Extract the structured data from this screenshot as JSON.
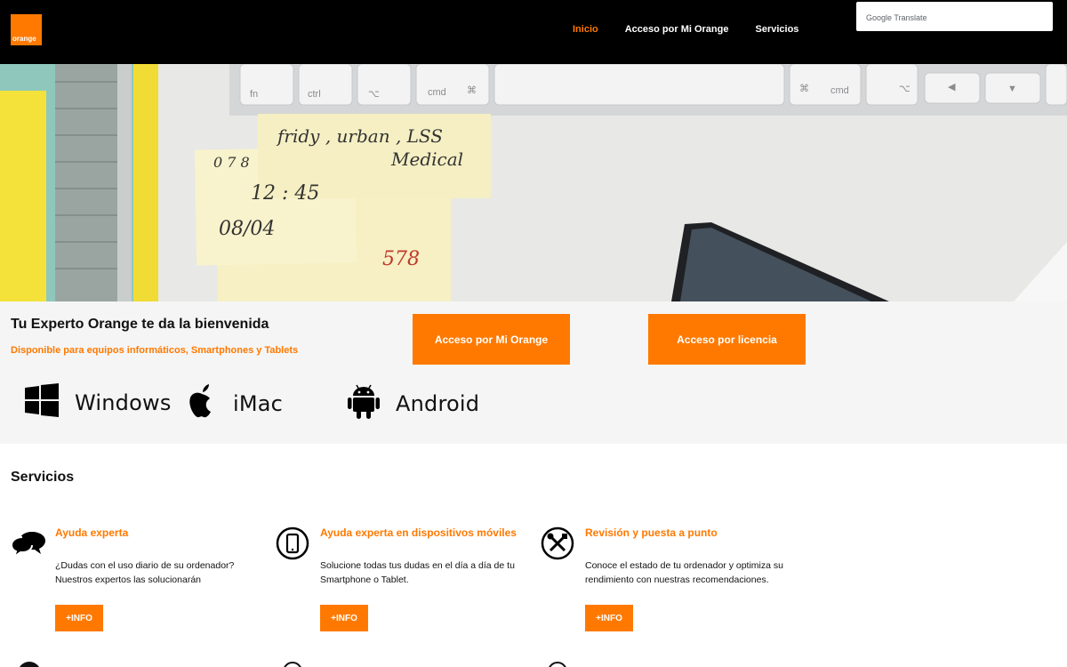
{
  "brand": {
    "logo_text": "orange",
    "accent": "#ff7900"
  },
  "nav": {
    "items": [
      {
        "label": "Inicio",
        "active": true
      },
      {
        "label": "Acceso por Mi Orange",
        "active": false
      },
      {
        "label": "Servicios",
        "active": false
      }
    ]
  },
  "translate": {
    "google": "Google",
    "label": "Translate"
  },
  "welcome": {
    "title": "Tu Experto Orange te da la bienvenida",
    "subtitle": "Disponible para equipos informáticos, Smartphones y Tablets",
    "buttons": {
      "mi_orange": "Acceso por Mi Orange",
      "licencia": "Acceso por licencia"
    },
    "platforms": [
      {
        "icon": "windows-icon",
        "label": "Windows"
      },
      {
        "icon": "apple-icon",
        "label": "iMac"
      },
      {
        "icon": "android-icon",
        "label": "Android"
      }
    ]
  },
  "services": {
    "title": "Servicios",
    "cards": [
      {
        "icon": "chat-bubbles-icon",
        "title": "Ayuda experta",
        "description": "¿Dudas con el uso diario de su ordenador? Nuestros expertos las solucionarán",
        "button": "+INFO"
      },
      {
        "icon": "smartphone-icon",
        "title": "Ayuda experta en dispositivos móviles",
        "description": "Solucione todas tus dudas en el día a día de tu Smartphone o Tablet.",
        "button": "+INFO"
      },
      {
        "icon": "tools-icon",
        "title": "Revisión y puesta a punto",
        "description": "Conoce el estado de tu ordenador y optimiza su rendimiento con nuestras recomendaciones.",
        "button": "+INFO"
      }
    ]
  },
  "hero": {
    "notes": [
      "fridy , urban , LSS",
      "Medical",
      "0 7 8",
      "12 : 45",
      "08/04",
      "578"
    ],
    "keys": [
      "fn",
      "ctrl",
      "⌥",
      "cmd",
      "⌘",
      "⌘",
      "cmd",
      "⌥",
      "◀",
      "▼"
    ]
  }
}
